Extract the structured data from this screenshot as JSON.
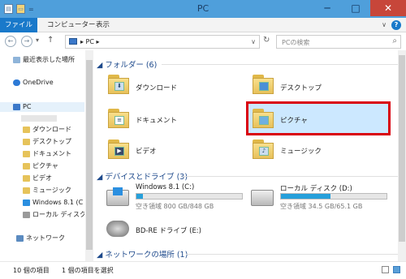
{
  "window": {
    "title": "PC",
    "minimize": "─",
    "maximize": "□",
    "close": "✕"
  },
  "qat": {
    "expand": "="
  },
  "ribbon": {
    "tabs": [
      "ファイル",
      "コンピューター",
      "表示"
    ],
    "minimize": "∨",
    "help": "?"
  },
  "nav": {
    "back": "←",
    "forward": "→",
    "recent": "▾",
    "up": "↑",
    "path": "▸ PC ▸",
    "dropdown": "∨",
    "refresh": "↻",
    "search_placeholder": "PCの検索",
    "search_icon": "⌕"
  },
  "sidebar": {
    "recent": "最近表示した場所",
    "onedrive": "OneDrive",
    "pc": "PC",
    "items": [
      "ダウンロード",
      "デスクトップ",
      "ドキュメント",
      "ピクチャ",
      "ビデオ",
      "ミュージック",
      "Windows 8.1 (C",
      "ローカル ディスク (D"
    ],
    "network": "ネットワーク"
  },
  "groups": {
    "folders": "フォルダー (6)",
    "drives": "デバイスとドライブ (3)",
    "network": "ネットワークの場所 (1)"
  },
  "folders": [
    "ダウンロード",
    "デスクトップ",
    "ドキュメント",
    "ピクチャ",
    "ビデオ",
    "ミュージック"
  ],
  "drives": [
    {
      "label": "Windows 8.1 (C:)",
      "size": "空き領域 800 GB/848 GB",
      "used": 0.06
    },
    {
      "label": "ローカル ディスク (D:)",
      "size": "空き領域 34.5 GB/65.1 GB",
      "used": 0.47
    },
    {
      "label": "BD-RE ドライブ (E:)"
    }
  ],
  "status": {
    "count": "10 個の項目",
    "selected": "1 個の項目を選択"
  },
  "colors": {
    "accent": "#1979ca",
    "selection_border": "#d9000d",
    "selection_fill": "#cce8ff"
  }
}
